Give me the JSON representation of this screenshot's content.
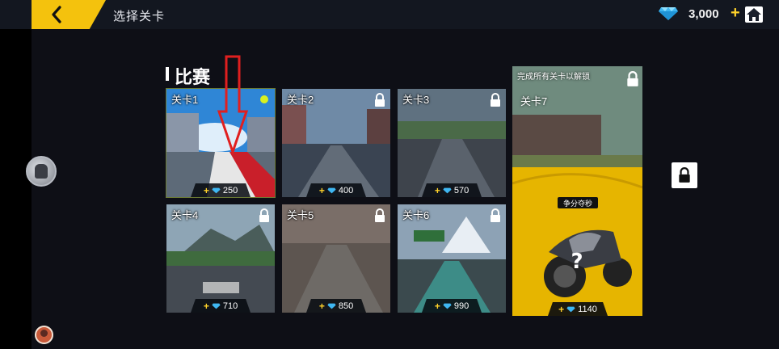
{
  "header": {
    "title": "选择关卡",
    "currency": "3,000",
    "plus": "+"
  },
  "section": {
    "title": "比赛"
  },
  "levels": [
    {
      "label": "关卡1",
      "reward": "250",
      "locked": false,
      "selected": true
    },
    {
      "label": "关卡2",
      "reward": "400",
      "locked": true
    },
    {
      "label": "关卡3",
      "reward": "570",
      "locked": true
    },
    {
      "label": "关卡4",
      "reward": "710",
      "locked": true
    },
    {
      "label": "关卡5",
      "reward": "850",
      "locked": true
    },
    {
      "label": "关卡6",
      "reward": "990",
      "locked": true
    }
  ],
  "special": {
    "unlock_text": "完成所有关卡以解锁",
    "label": "关卡7",
    "mode": "争分夺秒",
    "reward": "1140",
    "locked": true
  },
  "reward_plus": "+",
  "colors": {
    "accent": "#f4c20d",
    "gem": "#3fb7f2",
    "background": "#0e0f16"
  },
  "icons": [
    "back-arrow-icon",
    "diamond-icon",
    "home-icon",
    "lock-icon",
    "avatar-icon"
  ]
}
